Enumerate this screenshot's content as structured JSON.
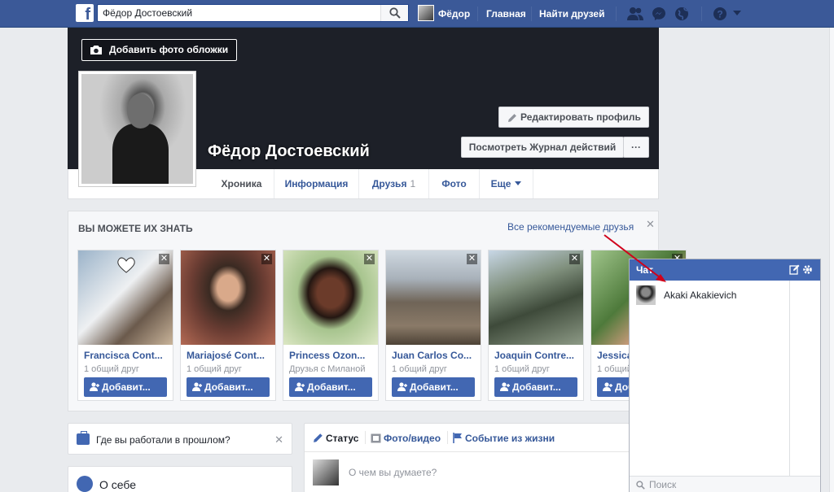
{
  "topbar": {
    "search_value": "Фёдор Достоевский",
    "user_name": "Фёдор",
    "home": "Главная",
    "find_friends": "Найти друзей"
  },
  "cover": {
    "add_cover": "Добавить фото обложки",
    "name": "Фёдор Достоевский",
    "edit_profile": "Редактировать профиль",
    "activity_log": "Посмотреть Журнал действий",
    "more": "···"
  },
  "tabs": [
    {
      "label": "Хроника",
      "count": ""
    },
    {
      "label": "Информация",
      "count": ""
    },
    {
      "label": "Друзья",
      "count": "1"
    },
    {
      "label": "Фото",
      "count": ""
    },
    {
      "label": "Еще",
      "count": ""
    }
  ],
  "pymk": {
    "title": "Вы можете их знать",
    "see_all": "Все рекомендуемые друзья",
    "close": "✕",
    "add_label": "Добавит...",
    "cards": [
      {
        "name": "Francisca Cont...",
        "mutual": "1 общий друг",
        "remove": "✕"
      },
      {
        "name": "Mariajosé Cont...",
        "mutual": "1 общий друг",
        "remove": "✕"
      },
      {
        "name": "Princess Ozon...",
        "mutual": "Друзья с Миланой",
        "remove": "✕"
      },
      {
        "name": "Juan Carlos Co...",
        "mutual": "1 общий друг",
        "remove": "✕"
      },
      {
        "name": "Joaquin Contre...",
        "mutual": "1 общий друг",
        "remove": "✕"
      },
      {
        "name": "Jessica...",
        "mutual": "1 общий друг",
        "remove": "✕"
      }
    ]
  },
  "work": {
    "text": "Где вы работали в прошлом?",
    "close": "✕"
  },
  "about": {
    "text": "О себе"
  },
  "composer": {
    "status": "Статус",
    "photo": "Фото/видео",
    "life_event": "Событие из жизни",
    "placeholder": "О чем вы думаете?"
  },
  "chat": {
    "title": "Чат",
    "contact": "Akaki Akakievich",
    "search_placeholder": "Поиск"
  },
  "colors": {
    "brand": "#3b5998",
    "button": "#4267b2",
    "link": "#365899",
    "arrow": "#d0021b"
  }
}
